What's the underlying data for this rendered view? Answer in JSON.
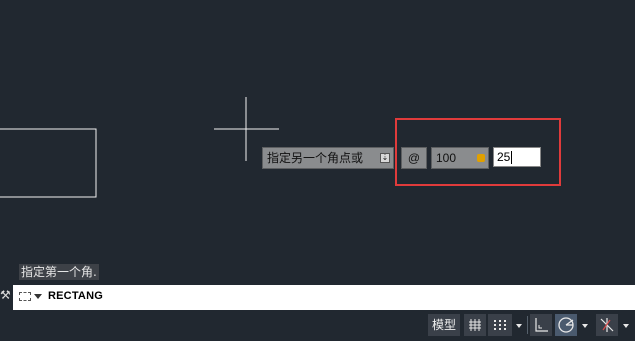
{
  "dynamic_input": {
    "prompt": "指定另一个角点或",
    "relative_symbol": "@",
    "x_value": "100",
    "y_value": "25"
  },
  "command_history": {
    "last_prompt": "指定第一个角."
  },
  "command_line": {
    "current_command": "RECTANG"
  },
  "status_bar": {
    "model_label": "模型"
  },
  "colors": {
    "canvas_bg": "#212830",
    "highlight": "#e03b3b"
  }
}
